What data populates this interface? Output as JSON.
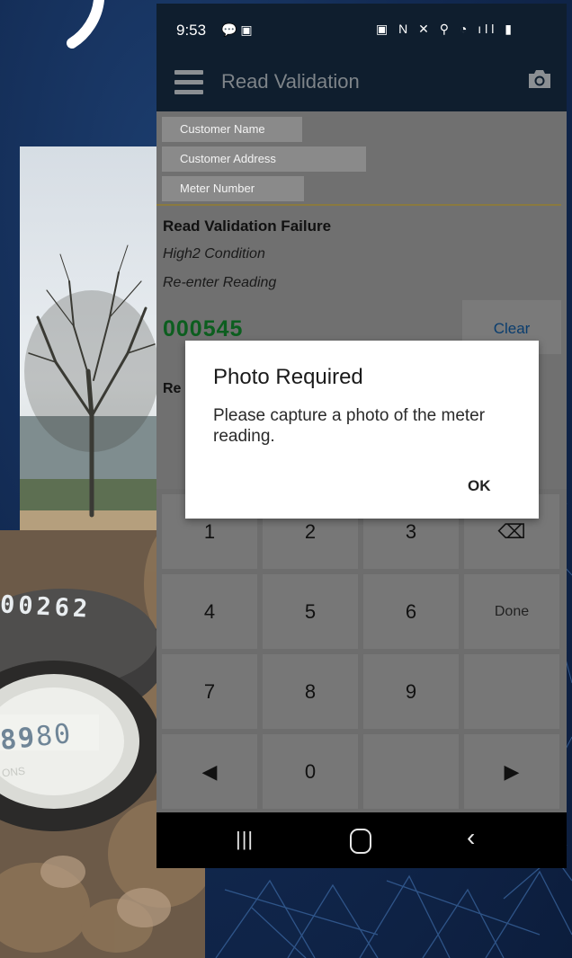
{
  "status_bar": {
    "time": "9:53",
    "left_icons": "💬 ▣",
    "right_icons": "▣ N ✕ ⚲ ◔ ıll ▮"
  },
  "app_bar": {
    "title": "Read Validation"
  },
  "customer": {
    "name_label": "Customer Name",
    "address_label": "Customer Address",
    "meter_label": "Meter Number"
  },
  "validation": {
    "title": "Read Validation Failure",
    "condition": "High2 Condition",
    "instruction": "Re-enter Reading",
    "reading": "000545",
    "clear_label": "Clear",
    "second_label": "Re"
  },
  "keypad": {
    "keys": [
      [
        "1",
        "2",
        "3",
        "⌫"
      ],
      [
        "4",
        "5",
        "6",
        "Done"
      ],
      [
        "7",
        "8",
        "9",
        ""
      ],
      [
        "◀",
        "0",
        "",
        "▶"
      ]
    ]
  },
  "nav_bar": {
    "recent": "|||",
    "back": "‹"
  },
  "dialog": {
    "title": "Photo Required",
    "message": "Please capture a photo of the meter reading.",
    "ok_label": "OK"
  },
  "meter_photo": {
    "odometer": "00262",
    "dial_digit_1": "89",
    "dial_digit_2": "80",
    "dial_small": "ONS"
  },
  "colors": {
    "app_bar": "#0f1e2e",
    "reading": "#0c5e1f",
    "clear": "#0a3d6e",
    "background": "#122a52"
  }
}
